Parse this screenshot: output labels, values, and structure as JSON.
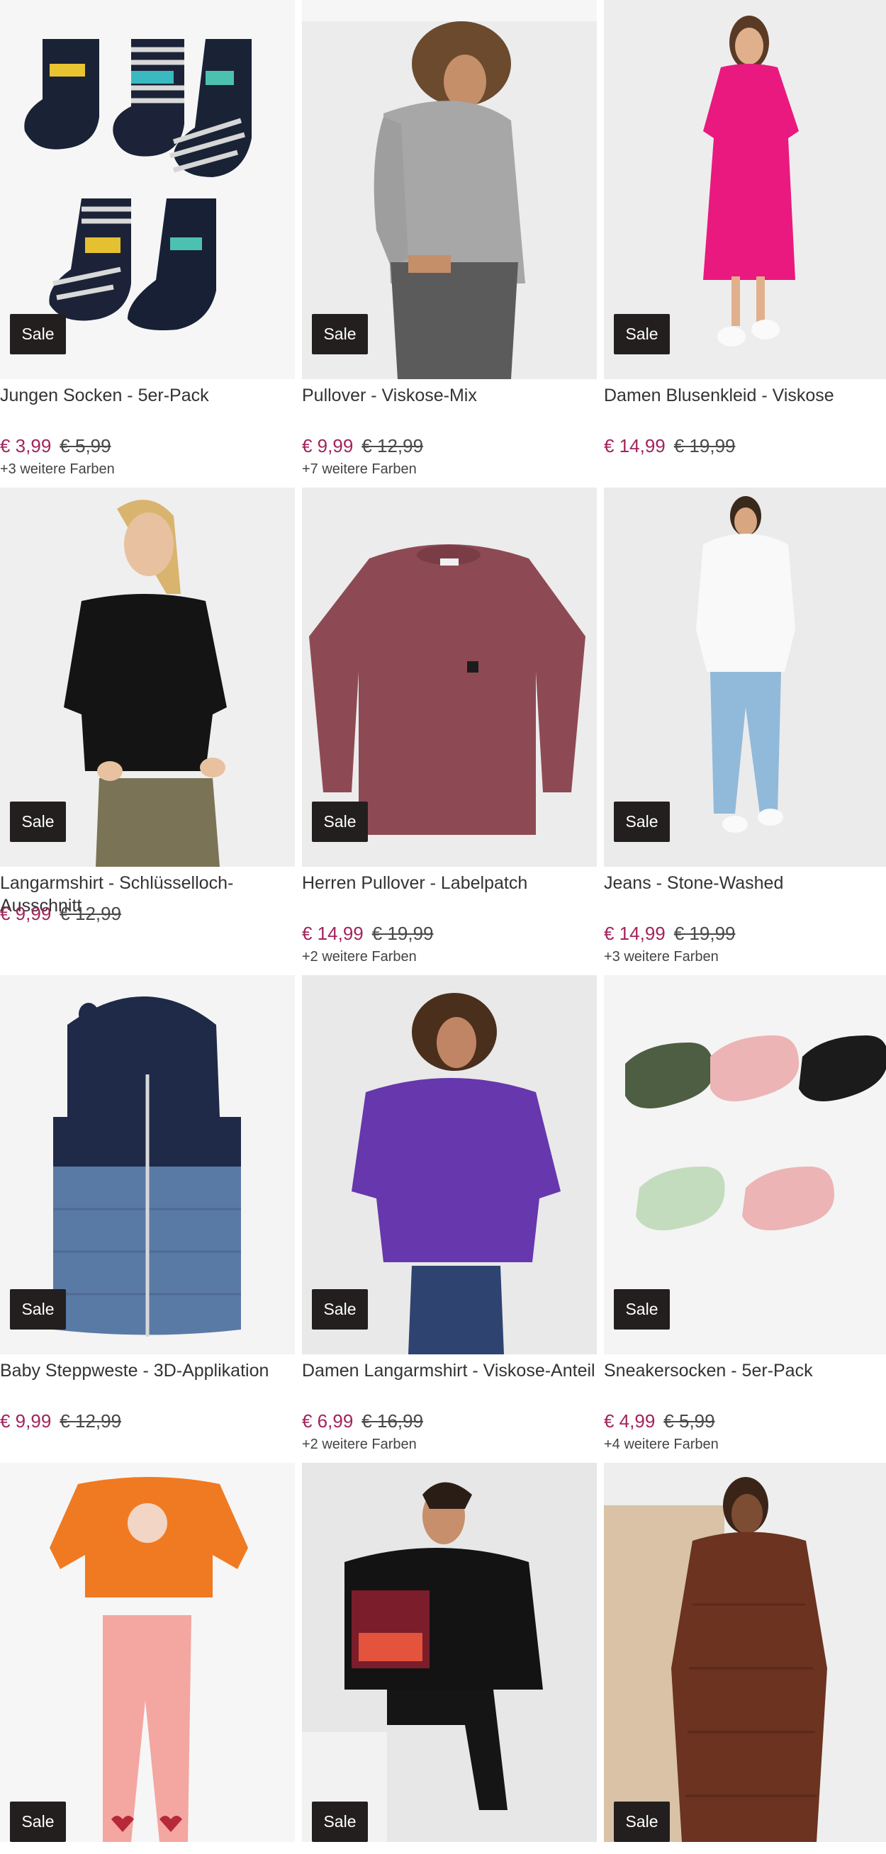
{
  "colors": {
    "sale_badge_bg": "#231f1f",
    "price_new": "#a2245c",
    "price_old": "#4a4a4a"
  },
  "products": [
    {
      "title": "Jungen Socken - 5er-Pack",
      "badge": "Sale",
      "price_new": "€ 3,99",
      "price_old": "€ 5,99",
      "colors_text": "+3 weitere Farben",
      "image": "kids-socks-image"
    },
    {
      "title": "Pullover - Viskose-Mix",
      "badge": "Sale",
      "price_new": "€ 9,99",
      "price_old": "€ 12,99",
      "colors_text": "+7 weitere Farben",
      "image": "grey-pullover-image"
    },
    {
      "title": "Damen Blusenkleid - Viskose",
      "badge": "Sale",
      "price_new": "€ 14,99",
      "price_old": "€ 19,99",
      "colors_text": "",
      "image": "pink-dress-image"
    },
    {
      "title": "Langarmshirt - Schlüsselloch-Ausschnitt",
      "badge": "Sale",
      "price_new": "€ 9,99",
      "price_old": "€ 12,99",
      "colors_text": "",
      "image": "black-longsleeve-image"
    },
    {
      "title": "Herren Pullover - Labelpatch",
      "badge": "Sale",
      "price_new": "€ 14,99",
      "price_old": "€ 19,99",
      "colors_text": "+2 weitere Farben",
      "image": "red-pullover-image"
    },
    {
      "title": "Jeans - Stone-Washed",
      "badge": "Sale",
      "price_new": "€ 14,99",
      "price_old": "€ 19,99",
      "colors_text": "+3 weitere Farben",
      "image": "light-jeans-image"
    },
    {
      "title": "Baby Steppweste - 3D-Applikation",
      "badge": "Sale",
      "price_new": "€ 9,99",
      "price_old": "€ 12,99",
      "colors_text": "",
      "image": "baby-vest-image"
    },
    {
      "title": "Damen Langarmshirt - Viskose-Anteil",
      "badge": "Sale",
      "price_new": "€ 6,99",
      "price_old": "€ 16,99",
      "colors_text": "+2 weitere Farben",
      "image": "purple-shirt-image"
    },
    {
      "title": "Sneakersocken - 5er-Pack",
      "badge": "Sale",
      "price_new": "€ 4,99",
      "price_old": "€ 5,99",
      "colors_text": "+4 weitere Farben",
      "image": "sneaker-socks-image"
    },
    {
      "title": "",
      "badge": "Sale",
      "price_new": "",
      "price_old": "",
      "colors_text": "",
      "image": "kids-set-image"
    },
    {
      "title": "",
      "badge": "Sale",
      "price_new": "",
      "price_old": "",
      "colors_text": "",
      "image": "black-hoodie-image"
    },
    {
      "title": "",
      "badge": "Sale",
      "price_new": "",
      "price_old": "",
      "colors_text": "",
      "image": "brown-coat-image"
    }
  ]
}
